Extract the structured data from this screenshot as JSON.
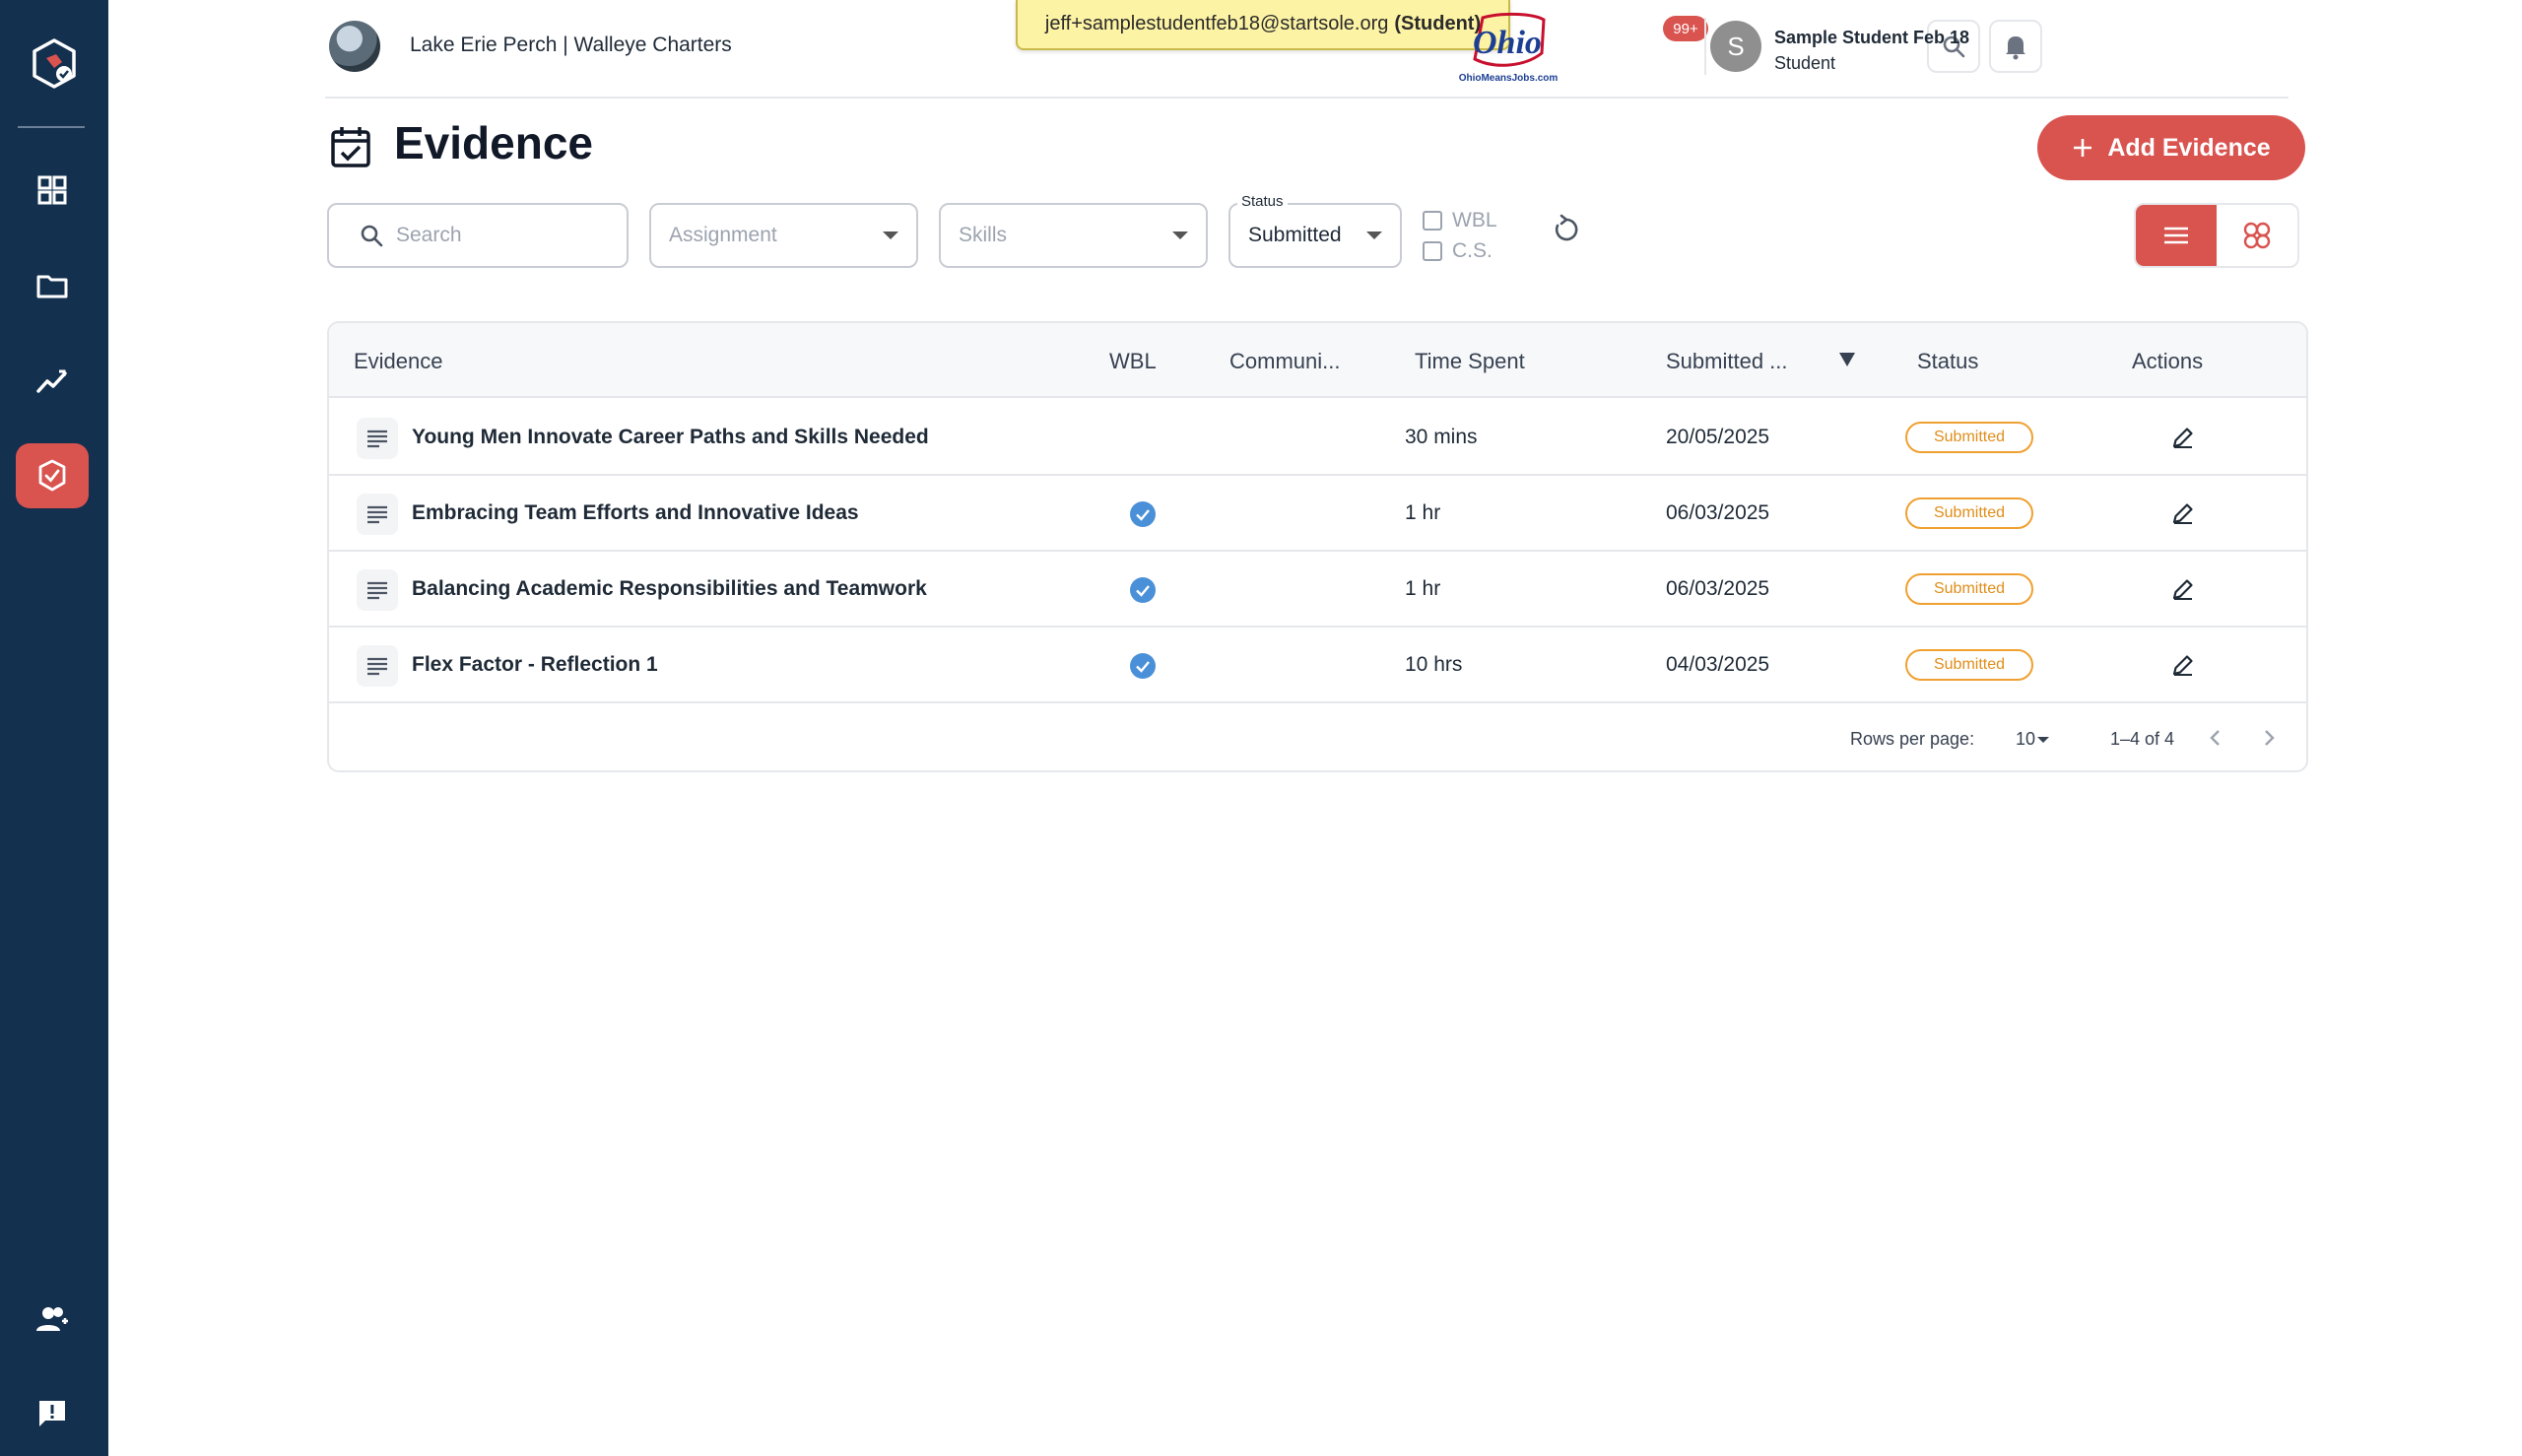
{
  "header": {
    "org_name": "Lake Erie Perch | Walleye Charters",
    "impersonation_email": "jeff+samplestudentfeb18@startsole.org",
    "impersonation_role": "(Student)",
    "logo_text": "Ohio",
    "logo_subtext": "OhioMeansJobs.com",
    "notification_count": "99+",
    "user_initial": "S",
    "user_name": "Sample Student Feb 18",
    "user_role": "Student"
  },
  "page": {
    "title": "Evidence",
    "add_button_label": "Add Evidence"
  },
  "filters": {
    "search_placeholder": "Search",
    "assignment_placeholder": "Assignment",
    "skills_placeholder": "Skills",
    "status_label": "Status",
    "status_value": "Submitted",
    "checkbox_wbl": "WBL",
    "checkbox_cs": "C.S."
  },
  "table": {
    "headers": {
      "evidence": "Evidence",
      "wbl": "WBL",
      "community": "Communi...",
      "time_spent": "Time Spent",
      "submitted": "Submitted ...",
      "status": "Status",
      "actions": "Actions"
    },
    "rows": [
      {
        "title": "Young Men Innovate Career Paths and Skills Needed",
        "wbl": false,
        "time": "30 mins",
        "date": "20/05/2025",
        "status": "Submitted"
      },
      {
        "title": "Embracing Team Efforts and Innovative Ideas",
        "wbl": true,
        "time": "1 hr",
        "date": "06/03/2025",
        "status": "Submitted"
      },
      {
        "title": "Balancing Academic Responsibilities and Teamwork",
        "wbl": true,
        "time": "1 hr",
        "date": "06/03/2025",
        "status": "Submitted"
      },
      {
        "title": "Flex Factor - Reflection 1",
        "wbl": true,
        "time": "10 hrs",
        "date": "04/03/2025",
        "status": "Submitted"
      }
    ]
  },
  "pagination": {
    "rows_per_page_label": "Rows per page:",
    "rows_per_page_value": "10",
    "range": "1–4 of 4"
  },
  "colors": {
    "sidebar": "#13304f",
    "accent": "#d9534f",
    "status_pill": "#f0a030",
    "check": "#4a90d9"
  }
}
